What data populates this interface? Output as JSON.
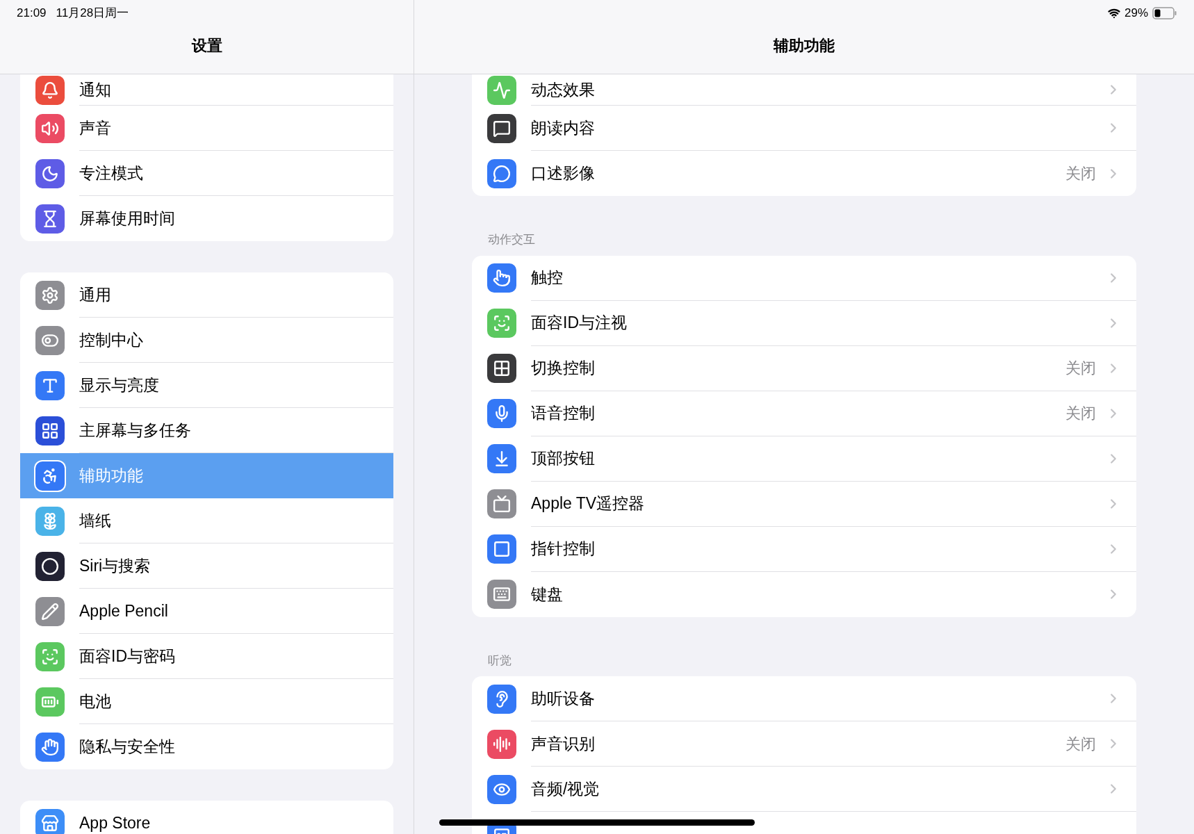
{
  "status_bar": {
    "time": "21:09",
    "date": "11月28日周一",
    "battery": "29%"
  },
  "sidebar": {
    "title": "设置",
    "groups": [
      {
        "items": [
          {
            "label": "通知",
            "color": "#eb4d3d",
            "selected": false
          },
          {
            "label": "声音",
            "color": "#eb4b63",
            "selected": false
          },
          {
            "label": "专注模式",
            "color": "#5e5ce6",
            "selected": false
          },
          {
            "label": "屏幕使用时间",
            "color": "#5e5ce6",
            "selected": false
          }
        ]
      },
      {
        "items": [
          {
            "label": "通用",
            "color": "#8e8e93",
            "selected": false
          },
          {
            "label": "控制中心",
            "color": "#8e8e93",
            "selected": false
          },
          {
            "label": "显示与亮度",
            "color": "#3478f6",
            "selected": false
          },
          {
            "label": "主屏幕与多任务",
            "color": "#2b4fd8",
            "selected": false
          },
          {
            "label": "辅助功能",
            "color": "#3478f6",
            "selected": true
          },
          {
            "label": "墙纸",
            "color": "#4ab3e8",
            "selected": false
          },
          {
            "label": "Siri与搜索",
            "color": "#222233",
            "selected": false
          },
          {
            "label": "Apple Pencil",
            "color": "#8e8e93",
            "selected": false
          },
          {
            "label": "面容ID与密码",
            "color": "#5bc85f",
            "selected": false
          },
          {
            "label": "电池",
            "color": "#5bc85f",
            "selected": false
          },
          {
            "label": "隐私与安全性",
            "color": "#3478f6",
            "selected": false
          }
        ]
      },
      {
        "items": [
          {
            "label": "App Store",
            "color": "#3d8ef7",
            "selected": false
          }
        ]
      }
    ]
  },
  "detail": {
    "title": "辅助功能",
    "sections": [
      {
        "rows": [
          {
            "label": "动态效果",
            "color": "#5bc85f"
          },
          {
            "label": "朗读内容",
            "color": "#3a3a3c"
          },
          {
            "label": "口述影像",
            "color": "#3478f6",
            "value": "关闭"
          }
        ]
      },
      {
        "header": "动作交互",
        "rows": [
          {
            "label": "触控",
            "color": "#3478f6"
          },
          {
            "label": "面容ID与注视",
            "color": "#5bc85f"
          },
          {
            "label": "切换控制",
            "color": "#3a3a3c",
            "value": "关闭"
          },
          {
            "label": "语音控制",
            "color": "#3478f6",
            "value": "关闭"
          },
          {
            "label": "顶部按钮",
            "color": "#3478f6"
          },
          {
            "label": "Apple TV遥控器",
            "color": "#8e8e93"
          },
          {
            "label": "指针控制",
            "color": "#3478f6"
          },
          {
            "label": "键盘",
            "color": "#8e8e93"
          }
        ]
      },
      {
        "header": "听觉",
        "rows": [
          {
            "label": "助听设备",
            "color": "#3478f6"
          },
          {
            "label": "声音识别",
            "color": "#eb4b63",
            "value": "关闭"
          },
          {
            "label": "音频/视觉",
            "color": "#3478f6"
          },
          {
            "color": "#3478f6"
          }
        ]
      }
    ]
  }
}
